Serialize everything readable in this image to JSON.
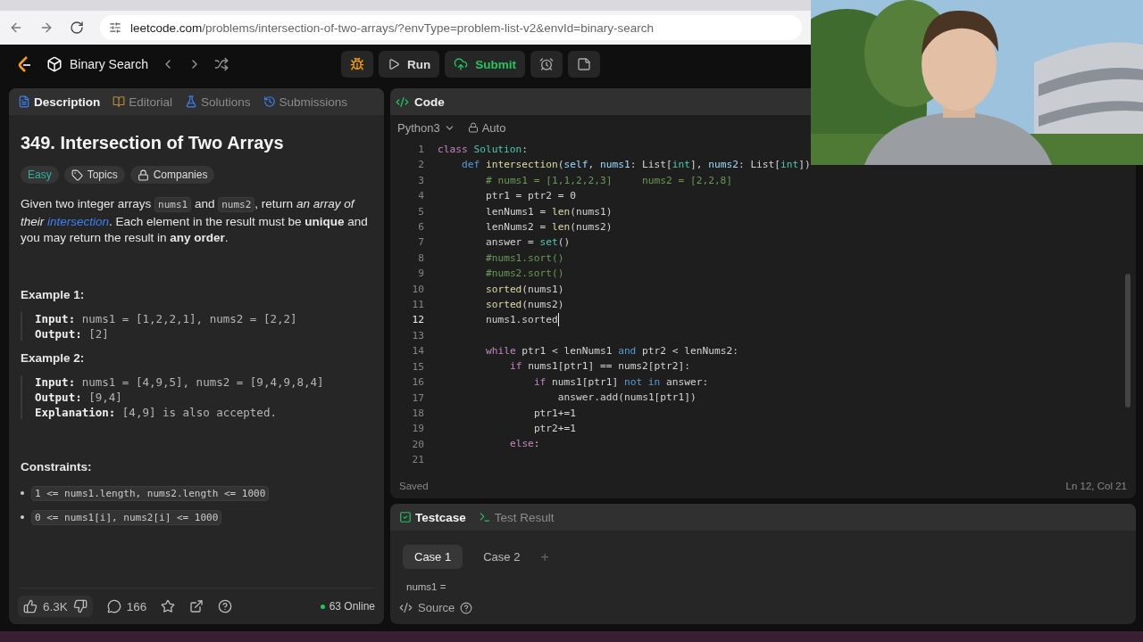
{
  "browser": {
    "url_host": "leetcode.com",
    "url_path": "/problems/intersection-of-two-arrays/?envType=problem-list-v2&envId=binary-search"
  },
  "header": {
    "list_name": "Binary Search",
    "run": "Run",
    "submit": "Submit"
  },
  "left_tabs": [
    {
      "label": "Description",
      "kind": "doc",
      "selected": true
    },
    {
      "label": "Editorial",
      "kind": "book",
      "selected": false
    },
    {
      "label": "Solutions",
      "kind": "flask",
      "selected": false
    },
    {
      "label": "Submissions",
      "kind": "history",
      "selected": false
    }
  ],
  "problem": {
    "title": "349. Intersection of Two Arrays",
    "difficulty": "Easy",
    "tags": [
      {
        "label": "Topics",
        "kind": "tag"
      },
      {
        "label": "Companies",
        "kind": "lock"
      }
    ],
    "description": [
      {
        "kind": "text",
        "t": "Given two integer arrays "
      },
      {
        "kind": "code",
        "t": "nums1"
      },
      {
        "kind": "text",
        "t": " and "
      },
      {
        "kind": "code",
        "t": "nums2"
      },
      {
        "kind": "text",
        "t": ", return *an array of their*"
      },
      {
        "kind": "link",
        "t": "intersection"
      },
      {
        "kind": "text",
        "t": ". Each element in the result must be **unique** and you may return the result in **any order**."
      }
    ],
    "examples": [
      {
        "title": "Example 1:",
        "lines": [
          {
            "label": "Input:",
            "value": "nums1 = [1,2,2,1], nums2 = [2,2]"
          },
          {
            "label": "Output:",
            "value": "[2]"
          }
        ]
      },
      {
        "title": "Example 2:",
        "lines": [
          {
            "label": "Input:",
            "value": "nums1 = [4,9,5], nums2 = [9,4,9,8,4]"
          },
          {
            "label": "Output:",
            "value": "[9,4]"
          },
          {
            "label": "Explanation:",
            "value": "[4,9] is also accepted."
          }
        ]
      }
    ],
    "constraints_title": "Constraints:",
    "constraints": [
      "1 <= nums1.length, nums2.length <= 1000",
      "0 <= nums1[i], nums2[i] <= 1000"
    ]
  },
  "footer": {
    "likes": "6.3K",
    "comments": "166",
    "online": "63 Online"
  },
  "code_panel": {
    "title": "Code",
    "language": "Python3",
    "mode": "Auto",
    "status": "Saved",
    "position": "Ln 12, Col 21",
    "lines": [
      {
        "number": "1",
        "current": false,
        "tokens": [
          {
            "kind": "kw",
            "t": "class "
          },
          {
            "kind": "type",
            "t": "Solution"
          },
          {
            "kind": "plain",
            "t": ":"
          }
        ],
        "children": [
          {
            "number": "2",
            "current": false,
            "tokens": [
              {
                "kind": "blue",
                "t": "def "
              },
              {
                "kind": "fn",
                "t": "intersection"
              },
              {
                "kind": "plain",
                "t": "("
              },
              {
                "kind": "var",
                "t": "self"
              },
              {
                "kind": "plain",
                "t": ", "
              },
              {
                "kind": "var",
                "t": "nums1"
              },
              {
                "kind": "plain",
                "t": ": List["
              },
              {
                "kind": "type",
                "t": "int"
              },
              {
                "kind": "plain",
                "t": "], "
              },
              {
                "kind": "var",
                "t": "nums2"
              },
              {
                "kind": "plain",
                "t": ": List["
              },
              {
                "kind": "type",
                "t": "int"
              },
              {
                "kind": "plain",
                "t": "])"
              }
            ],
            "children": [
              {
                "number": "3",
                "current": false,
                "tokens": [
                  {
                    "kind": "cm",
                    "t": "# nums1 = [1,1,2,2,3]     nums2 = [2,2,8]"
                  }
                ]
              },
              {
                "number": "4",
                "current": false,
                "tokens": [
                  {
                    "kind": "plain",
                    "t": "ptr1 = ptr2 = 0"
                  }
                ]
              },
              {
                "number": "5",
                "current": false,
                "tokens": [
                  {
                    "kind": "plain",
                    "t": "lenNums1 = "
                  },
                  {
                    "kind": "fn",
                    "t": "len"
                  },
                  {
                    "kind": "plain",
                    "t": "(nums1)"
                  }
                ]
              },
              {
                "number": "6",
                "current": false,
                "tokens": [
                  {
                    "kind": "plain",
                    "t": "lenNums2 = "
                  },
                  {
                    "kind": "fn",
                    "t": "len"
                  },
                  {
                    "kind": "plain",
                    "t": "(nums2)"
                  }
                ]
              },
              {
                "number": "7",
                "current": false,
                "tokens": [
                  {
                    "kind": "plain",
                    "t": "answer = "
                  },
                  {
                    "kind": "type",
                    "t": "set"
                  },
                  {
                    "kind": "plain",
                    "t": "()"
                  }
                ]
              },
              {
                "number": "8",
                "current": false,
                "tokens": [
                  {
                    "kind": "cm",
                    "t": "#nums1.sort()"
                  }
                ]
              },
              {
                "number": "9",
                "current": false,
                "tokens": [
                  {
                    "kind": "cm",
                    "t": "#nums2.sort()"
                  }
                ]
              },
              {
                "number": "10",
                "current": false,
                "tokens": [
                  {
                    "kind": "fn",
                    "t": "sorted"
                  },
                  {
                    "kind": "plain",
                    "t": "(nums1)"
                  }
                ]
              },
              {
                "number": "11",
                "current": false,
                "tokens": [
                  {
                    "kind": "fn",
                    "t": "sorted"
                  },
                  {
                    "kind": "plain",
                    "t": "(nums2)"
                  }
                ]
              },
              {
                "number": "12",
                "current": true,
                "tokens": [
                  {
                    "kind": "plain",
                    "t": "nums1.sorted"
                  }
                ]
              },
              {
                "number": "13",
                "current": false
              },
              {
                "number": "14",
                "current": false,
                "tokens": [
                  {
                    "kind": "kw",
                    "t": "while"
                  },
                  {
                    "kind": "plain",
                    "t": " ptr1 < lenNums1 "
                  },
                  {
                    "kind": "blue",
                    "t": "and"
                  },
                  {
                    "kind": "plain",
                    "t": " ptr2 < lenNums2:"
                  }
                ],
                "children": [
                  {
                    "number": "15",
                    "current": false,
                    "tokens": [
                      {
                        "kind": "kw",
                        "t": "if"
                      },
                      {
                        "kind": "plain",
                        "t": " nums1[ptr1] == nums2[ptr2]:"
                      }
                    ],
                    "children": [
                      {
                        "number": "16",
                        "current": false,
                        "tokens": [
                          {
                            "kind": "kw",
                            "t": "if"
                          },
                          {
                            "kind": "plain",
                            "t": " nums1[ptr1] "
                          },
                          {
                            "kind": "blue",
                            "t": "not in"
                          },
                          {
                            "kind": "plain",
                            "t": " answer:"
                          }
                        ],
                        "children": [
                          {
                            "number": "17",
                            "current": false,
                            "tokens": [
                              {
                                "kind": "plain",
                                "t": "answer.add(nums1[ptr1])"
                              }
                            ]
                          }
                        ]
                      },
                      {
                        "number": "18",
                        "current": false,
                        "tokens": [
                          {
                            "kind": "plain",
                            "t": "ptr1+=1"
                          }
                        ]
                      },
                      {
                        "number": "19",
                        "current": false,
                        "tokens": [
                          {
                            "kind": "plain",
                            "t": "ptr2+=1"
                          }
                        ]
                      }
                    ]
                  },
                  {
                    "number": "20",
                    "current": false,
                    "tokens": [
                      {
                        "kind": "kw",
                        "t": "else"
                      },
                      {
                        "kind": "plain",
                        "t": ":"
                      }
                    ]
                  }
                ]
              },
              {
                "number": "21",
                "current": false
              }
            ]
          }
        ]
      }
    ]
  },
  "test_panel": {
    "tabs": [
      {
        "label": "Testcase",
        "kind": "check",
        "selected": true
      },
      {
        "label": "Test Result",
        "kind": "terminal",
        "selected": false
      }
    ],
    "cases": [
      {
        "label": "Case 1",
        "selected": true
      },
      {
        "label": "Case 2",
        "selected": false
      }
    ],
    "add": "+",
    "param": "nums1 =",
    "source": "Source"
  }
}
